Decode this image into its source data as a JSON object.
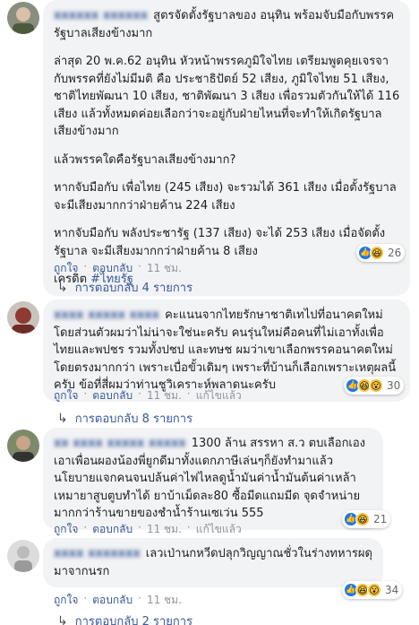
{
  "comments": [
    {
      "author": "xxxxxx xxxxxx",
      "lines": [
        "สูตรจัดตั้งรัฐบาลของ อนุทิน พร้อมจับมือกับพรรครัฐบาลเสียงข้างมาก",
        "ล่าสุด 20 พ.ค.62 อนุทิน หัวหน้าพรรคภูมิใจไทย เตรียมพูดคุยเจรจากับพรรคที่ยังไม่มีมติ คือ ประชาธิปัตย์ 52 เสียง, ภูมิใจไทย 51 เสียง, ชาติไทยพัฒนา 10 เสียง, ชาติพัฒนา 3 เสียง เพื่อรวมตัวกันให้ได้ 116 เสียง แล้วทั้งหมดค่อยเลือกว่าจะอยู่กับฝ่ายไหนที่จะทำให้เกิดรัฐบาลเสียงข้างมาก",
        "แล้วพรรคใดคือรัฐบาลเสียงข้างมาก?",
        "หากจับมือกับ เพื่อไทย (245 เสียง) จะรวมได้ 361 เสียง เมื่อตั้งรัฐบาล จะมีเสียงมากกว่าฝ่ายค้าน 224 เสียง",
        "หากจับมือกับ พลังประชารัฐ (137 เสียง) จะได้ 253 เสียง เมื่อจัดตั้งรัฐบาล จะมีเสียงมากกว่าฝ่ายค้าน 8 เสียง"
      ],
      "credit_label": "เครดิต",
      "hashtag": "#ไทยรัฐ",
      "reaction_count": "26",
      "like_label": "ถูกใจ",
      "reply_label": "ตอบกลับ",
      "time": "11 ชม.",
      "replies_label": "การตอบกลับ 4 รายการ"
    },
    {
      "author": "xxxx xxxxx xxxx",
      "text": "คะแนนจากไทยรักษาชาติเทไปที่อนาคตใหม่ โดยส่วนตัวผมว่าไม่น่าจะใช่นะครับ คนรุ่นใหม่คือคนที่ไม่เอาทั้งเพื่อไทยและพปชร รวมทั้งปชป และทษช ผมว่าเขาเลือกพรรคอนาคตใหม่โดยตรงมากกว่า เพราะเบื่อขั้วเดิมๆ เพราะที่บ้านก็เลือกเพราะเหตุผลนี้ครับ ข้อที่สี่ผมว่าท่านชูวิเคราะห์พลาดนะครับ",
      "reaction_count": "30",
      "like_label": "ถูกใจ",
      "reply_label": "ตอบกลับ",
      "time": "11 ชม.",
      "edited_label": "แก้ไขแล้ว",
      "replies_label": "การตอบกลับ 8 รายการ"
    },
    {
      "author": "xx xxxx xxxxx xxxxx",
      "text": "1300 ล้าน สรรหา ส.ว ตบเลือกเองเอาเพื่อนผองน้องพี่ยูกดีมาทั้งแดกภาษีเล่นๆก็ยังทำมาแล้ว นโยบายแจกคนจนปล้นค่าไฟไหลดูน้ำมันค่าน้ำมันต้นค่าเหล้าเหมายาสูบตูบทำได้ ยาบ้าเม็ดละ80 ซื้อมีดแถมมีด จุดจำหน่ายมากกว่าร้านขายของชำน้ำร้านเซเว่น 555",
      "reaction_count": "21",
      "like_label": "ถูกใจ",
      "reply_label": "ตอบกลับ",
      "time": "11 ชม.",
      "edited_label": "แก้ไขแล้ว"
    },
    {
      "author": "xxxx xxxxxxx",
      "text": "เลวเป่านกหวีดปลุกวิญญาณชั่วในร่างทหารผดุมาจากนรก",
      "reaction_count": "34",
      "like_label": "ถูกใจ",
      "reply_label": "ตอบกลับ",
      "time": "11 ชม.",
      "replies_label": "การตอบกลับ 2 รายการ"
    }
  ]
}
